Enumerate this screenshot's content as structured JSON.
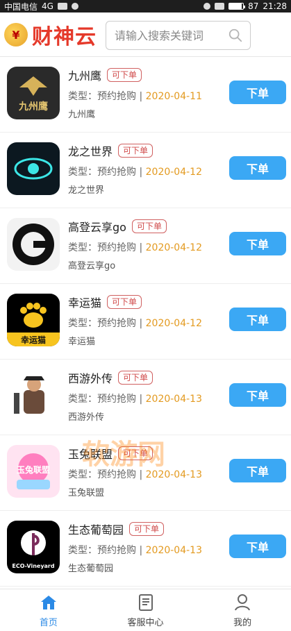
{
  "status_bar": {
    "carrier": "中国电信",
    "network": "4G",
    "battery_percent": "87",
    "time": "21:28"
  },
  "header": {
    "logo_text": "财神云",
    "search_placeholder": "请输入搜索关键词"
  },
  "items": [
    {
      "title": "九州鹰",
      "badge": "可下单",
      "type_label": "类型：预约抢购 |",
      "date": "2020-04-11",
      "sub": "九州鹰",
      "btn": "下单"
    },
    {
      "title": "龙之世界",
      "badge": "可下单",
      "type_label": "类型：预约抢购 |",
      "date": "2020-04-12",
      "sub": "龙之世界",
      "btn": "下单"
    },
    {
      "title": "高登云享go",
      "badge": "可下单",
      "type_label": "类型：预约抢购 |",
      "date": "2020-04-12",
      "sub": "高登云享go",
      "btn": "下单"
    },
    {
      "title": "幸运猫",
      "badge": "可下单",
      "type_label": "类型：预约抢购 |",
      "date": "2020-04-12",
      "sub": "幸运猫",
      "btn": "下单"
    },
    {
      "title": "西游外传",
      "badge": "可下单",
      "type_label": "类型：预约抢购 |",
      "date": "2020-04-13",
      "sub": "西游外传",
      "btn": "下单"
    },
    {
      "title": "玉兔联盟",
      "badge": "可下单",
      "type_label": "类型：预约抢购 |",
      "date": "2020-04-13",
      "sub": "玉兔联盟",
      "btn": "下单"
    },
    {
      "title": "生态葡萄园",
      "badge": "可下单",
      "type_label": "类型：预约抢购 |",
      "date": "2020-04-13",
      "sub": "生态葡萄园",
      "btn": "下单"
    }
  ],
  "app_icon_text": {
    "jiuzhouying": "九州鹰",
    "xingyunmao": "幸运猫",
    "yutu": "玉兔联盟",
    "eco": "ECO-Vineyard"
  },
  "watermark": "软游网",
  "bottom_nav": {
    "home": "首页",
    "service": "客服中心",
    "mine": "我的"
  },
  "colors": {
    "accent_blue": "#3ba8f4",
    "date_orange": "#e39a20",
    "badge_red": "#d04b4b",
    "logo_red": "#e5392a"
  }
}
